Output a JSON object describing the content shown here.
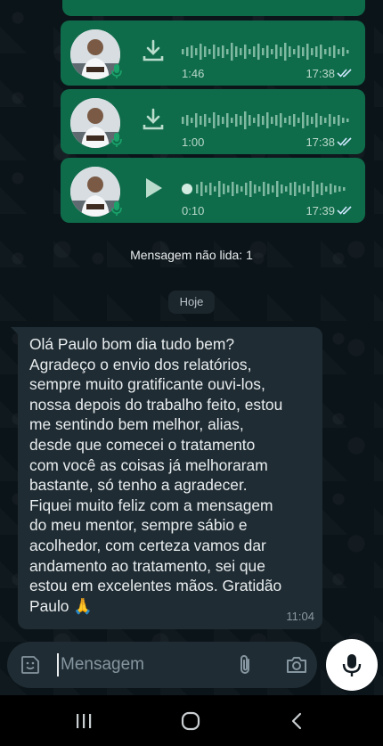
{
  "colors": {
    "outgoing_bubble": "#0f6c4a",
    "incoming_bubble": "#1f2c33",
    "chat_background": "#0b1419",
    "read_ticks": "#9fd6ff"
  },
  "voice_messages": [
    {
      "action_icon": "download-icon",
      "duration": "1:46",
      "time": "17:38",
      "status": "read"
    },
    {
      "action_icon": "download-icon",
      "duration": "1:00",
      "time": "17:38",
      "status": "read"
    },
    {
      "action_icon": "play-icon",
      "duration": "0:10",
      "time": "17:39",
      "status": "read"
    }
  ],
  "unread_banner": "Mensagem não lida: 1",
  "date_divider": "Hoje",
  "incoming_message": {
    "text": "Olá Paulo bom dia tudo bem?\nAgradeço o envio dos relatórios,\nsempre muito gratificante ouvi-los,\nnossa depois do trabalho feito, estou\nme sentindo bem melhor, alias,\ndesde que comecei o tratamento\ncom você as coisas já melhoraram\nbastante, só tenho a agradecer.\nFiquei muito feliz com a mensagem\ndo meu mentor, sempre sábio e\nacolhedor, com certeza vamos dar\nandamento ao tratamento, sei que\nestou em excelentes mãos. Gratidão\nPaulo 🙏",
    "time": "11:04"
  },
  "composer": {
    "placeholder": "Mensagem",
    "value": ""
  },
  "icons": {
    "emoji": "sticker-icon",
    "attach": "paperclip-icon",
    "camera": "camera-icon",
    "mic": "mic-icon",
    "nav_recents": "recents-icon",
    "nav_home": "home-icon",
    "nav_back": "back-icon"
  }
}
